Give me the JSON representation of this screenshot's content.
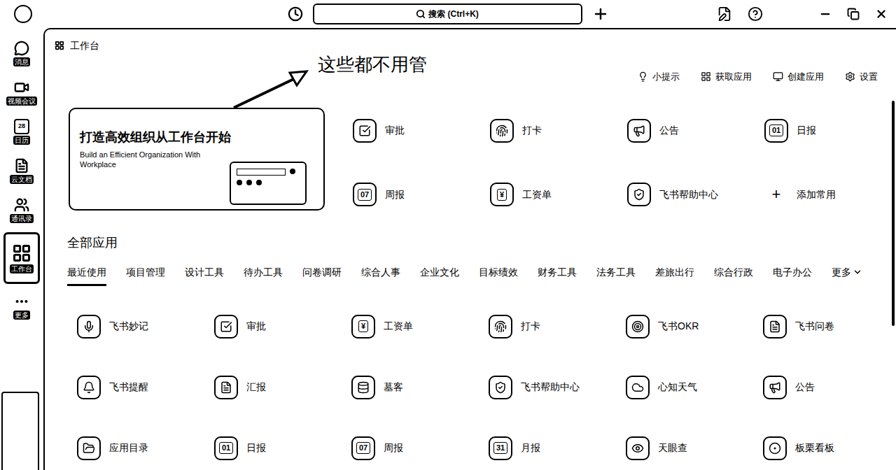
{
  "topbar": {
    "search_placeholder": "搜索 (Ctrl+K)"
  },
  "sidebar": {
    "items": [
      {
        "label": "消息",
        "selected": false
      },
      {
        "label": "视频会议",
        "selected": false
      },
      {
        "label": "日历",
        "selected": false,
        "glyph": "28"
      },
      {
        "label": "云文档",
        "selected": false
      },
      {
        "label": "通讯录",
        "selected": false
      },
      {
        "label": "工作台",
        "selected": true
      },
      {
        "label": "更多",
        "selected": false
      }
    ]
  },
  "page": {
    "title": "工作台",
    "annotation": "这些都不用管",
    "toolbar": [
      "小提示",
      "获取应用",
      "创建应用",
      "设置"
    ]
  },
  "banner": {
    "title": "打造高效组织从工作台开始",
    "subtitle": "Build an Efficient Organization With Workplace"
  },
  "common_apps": [
    {
      "label": "审批",
      "kind": "app"
    },
    {
      "label": "打卡",
      "kind": "app"
    },
    {
      "label": "公告",
      "kind": "app"
    },
    {
      "label": "日报",
      "kind": "app",
      "glyph": "01"
    },
    {
      "label": "周报",
      "kind": "app",
      "glyph": "07"
    },
    {
      "label": "工资单",
      "kind": "app",
      "glyph": "¥"
    },
    {
      "label": "飞书帮助中心",
      "kind": "app"
    },
    {
      "label": "添加常用",
      "kind": "add",
      "glyph": "+"
    }
  ],
  "all_apps": {
    "title": "全部应用",
    "tabs": [
      {
        "label": "最近使用",
        "selected": true
      },
      {
        "label": "项目管理",
        "selected": false
      },
      {
        "label": "设计工具",
        "selected": false
      },
      {
        "label": "待办工具",
        "selected": false
      },
      {
        "label": "问卷调研",
        "selected": false
      },
      {
        "label": "综合人事",
        "selected": false
      },
      {
        "label": "企业文化",
        "selected": false
      },
      {
        "label": "目标绩效",
        "selected": false
      },
      {
        "label": "财务工具",
        "selected": false
      },
      {
        "label": "法务工具",
        "selected": false
      },
      {
        "label": "差旅出行",
        "selected": false
      },
      {
        "label": "综合行政",
        "selected": false
      },
      {
        "label": "电子办公",
        "selected": false
      }
    ],
    "more": "更多",
    "apps": [
      {
        "label": "飞书妙记"
      },
      {
        "label": "审批"
      },
      {
        "label": "工资单",
        "glyph": "¥"
      },
      {
        "label": "打卡"
      },
      {
        "label": "飞书OKR"
      },
      {
        "label": "飞书问卷"
      },
      {
        "label": "飞书提醒"
      },
      {
        "label": "汇报"
      },
      {
        "label": "墓客"
      },
      {
        "label": "飞书帮助中心"
      },
      {
        "label": "心知天气"
      },
      {
        "label": "公告"
      },
      {
        "label": "应用目录"
      },
      {
        "label": "日报",
        "glyph": "01"
      },
      {
        "label": "周报",
        "glyph": "07"
      },
      {
        "label": "月报",
        "glyph": "31"
      },
      {
        "label": "天眼查"
      },
      {
        "label": "板栗看板"
      }
    ]
  }
}
